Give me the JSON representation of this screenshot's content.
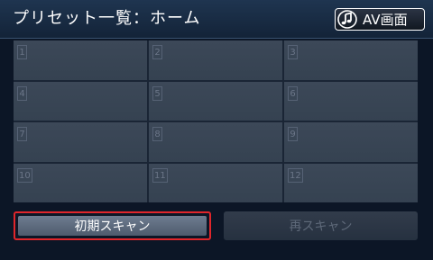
{
  "header": {
    "title": "プリセット一覧：ホーム",
    "av_label": "AV画面"
  },
  "presets": [
    "1",
    "2",
    "3",
    "4",
    "5",
    "6",
    "7",
    "8",
    "9",
    "10",
    "11",
    "12"
  ],
  "buttons": {
    "initial_scan": "初期スキャン",
    "rescan": "再スキャン"
  },
  "colors": {
    "highlight": "#e0262b",
    "background": "#0c1626"
  }
}
